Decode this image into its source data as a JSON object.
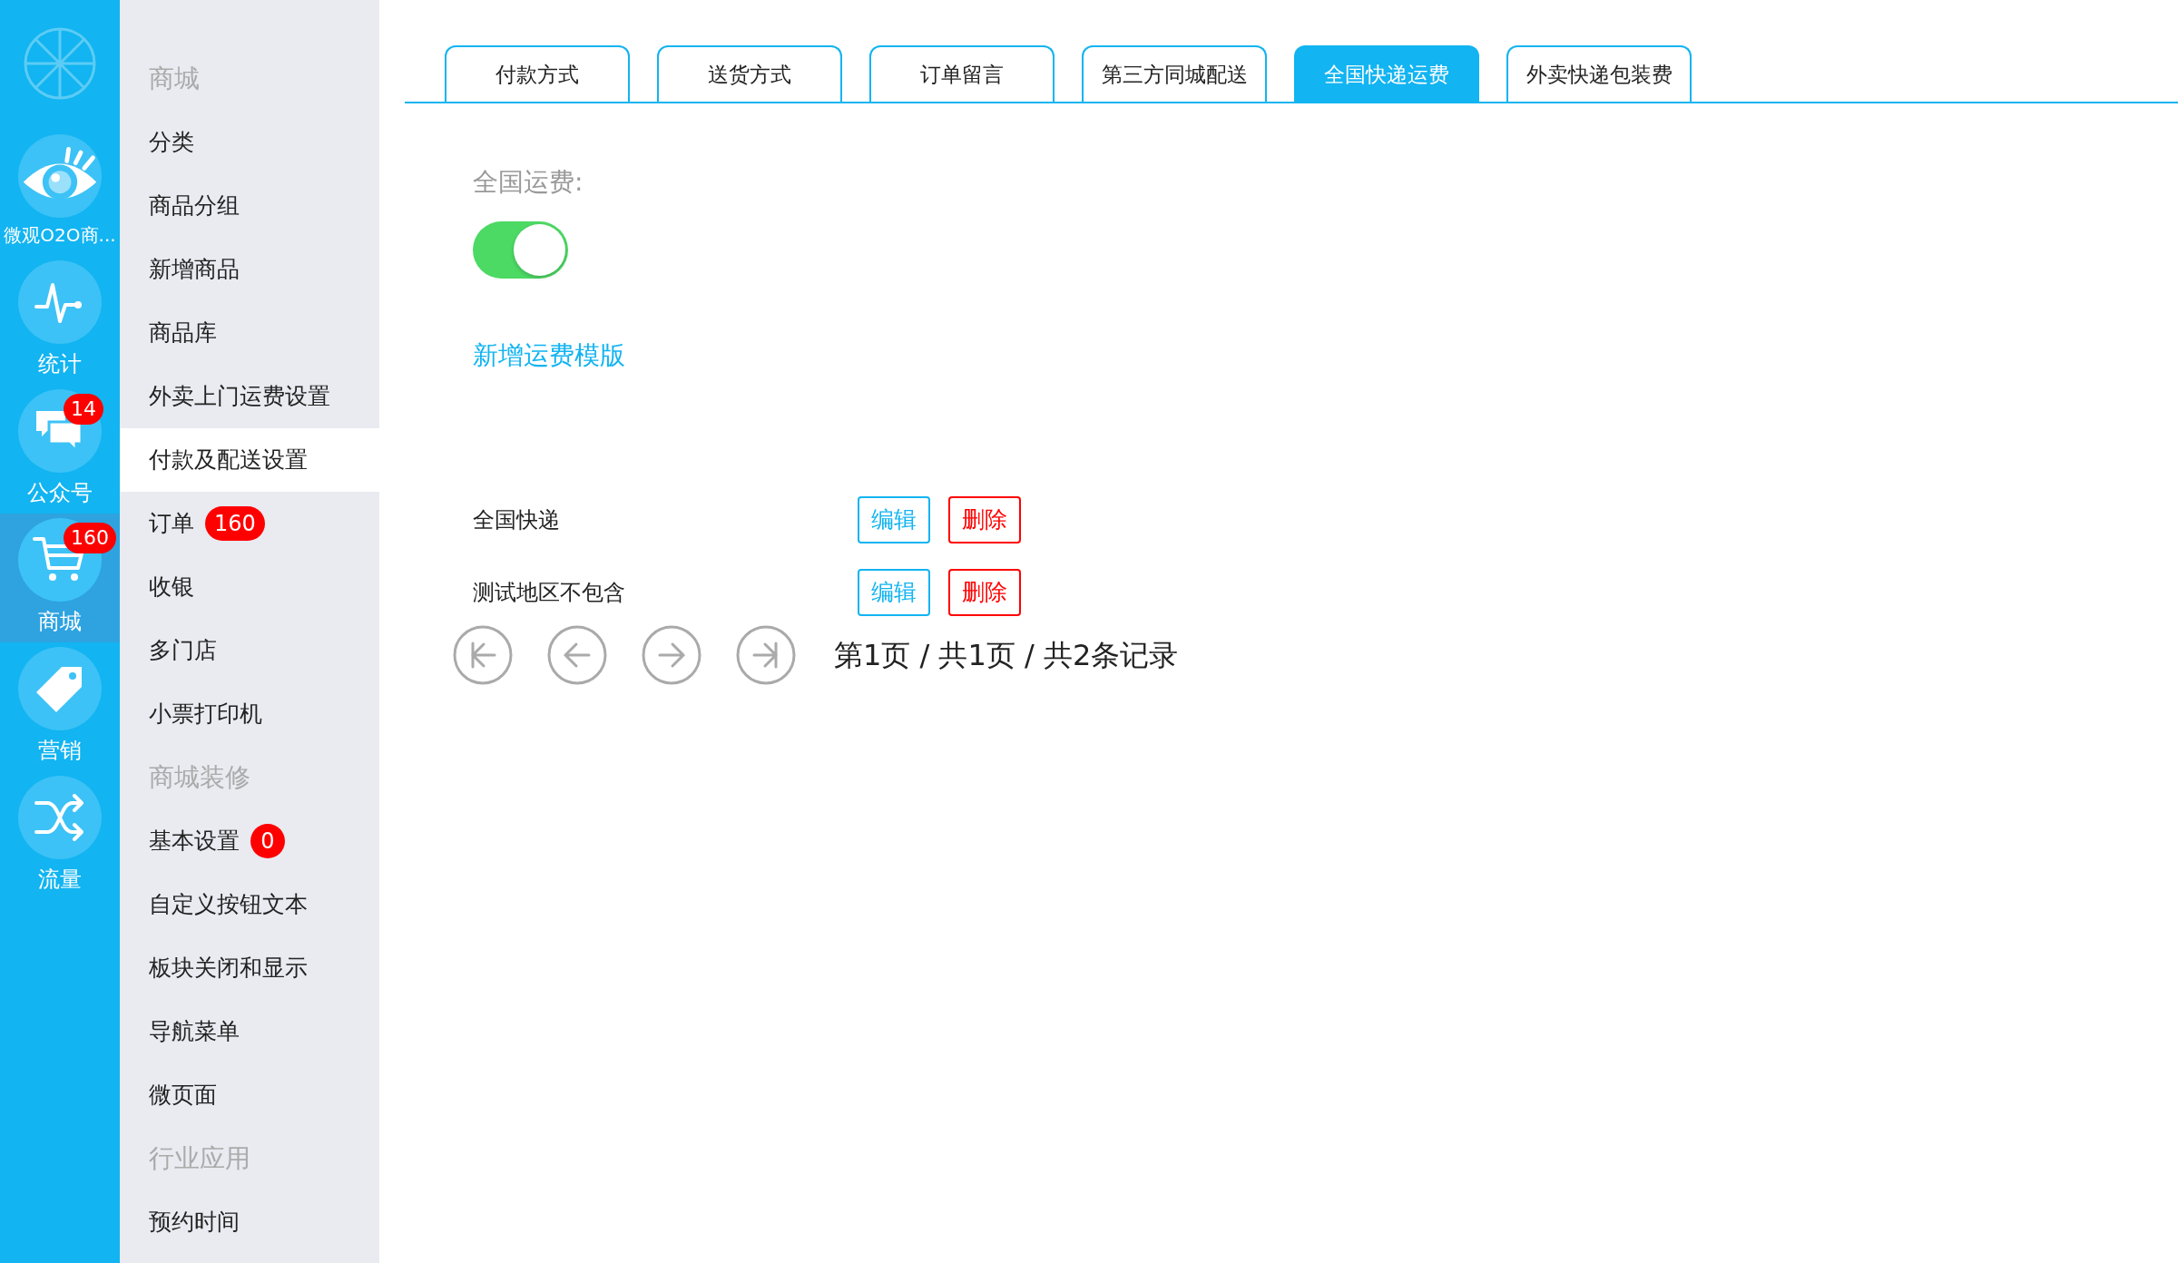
{
  "rail": {
    "items": [
      {
        "label": "微观O2O商...",
        "selected": false
      },
      {
        "label": "统计",
        "selected": false
      },
      {
        "label": "公众号",
        "badge": "14",
        "selected": false
      },
      {
        "label": "商城",
        "badge": "160",
        "selected": true
      },
      {
        "label": "营销",
        "selected": false
      },
      {
        "label": "流量",
        "selected": false
      }
    ]
  },
  "sidebar": {
    "items": [
      {
        "kind": "heading",
        "label": "商城",
        "selected": false
      },
      {
        "kind": "link",
        "label": "分类",
        "selected": false
      },
      {
        "kind": "link",
        "label": "商品分组",
        "selected": false
      },
      {
        "kind": "link",
        "label": "新增商品",
        "selected": false
      },
      {
        "kind": "link",
        "label": "商品库",
        "selected": false
      },
      {
        "kind": "link",
        "label": "外卖上门运费设置",
        "selected": false
      },
      {
        "kind": "link",
        "label": "付款及配送设置",
        "selected": true
      },
      {
        "kind": "link",
        "label": "订单",
        "badge": "160",
        "selected": false
      },
      {
        "kind": "link",
        "label": "收银",
        "selected": false
      },
      {
        "kind": "link",
        "label": "多门店",
        "selected": false
      },
      {
        "kind": "link",
        "label": "小票打印机",
        "selected": false
      },
      {
        "kind": "heading",
        "label": "商城装修",
        "selected": false
      },
      {
        "kind": "link",
        "label": "基本设置",
        "badge": "0",
        "selected": false
      },
      {
        "kind": "link",
        "label": "自定义按钮文本",
        "selected": false
      },
      {
        "kind": "link",
        "label": "板块关闭和显示",
        "selected": false
      },
      {
        "kind": "link",
        "label": "导航菜单",
        "selected": false
      },
      {
        "kind": "link",
        "label": "微页面",
        "selected": false
      },
      {
        "kind": "heading",
        "label": "行业应用",
        "selected": false
      },
      {
        "kind": "link",
        "label": "预约时间",
        "selected": false
      }
    ]
  },
  "tabs": [
    {
      "label": "付款方式",
      "selected": false
    },
    {
      "label": "送货方式",
      "selected": false
    },
    {
      "label": "订单留言",
      "selected": false
    },
    {
      "label": "第三方同城配送",
      "selected": false
    },
    {
      "label": "全国快递运费",
      "selected": true
    },
    {
      "label": "外卖快递包装费",
      "selected": false
    }
  ],
  "content": {
    "fee_label": "全国运费:",
    "fee_toggle": {
      "on": true
    },
    "add_link": "新增运费模版",
    "templates": [
      {
        "name": "全国快递",
        "edit": "编辑",
        "delete": "删除"
      },
      {
        "name": "测试地区不包含",
        "edit": "编辑",
        "delete": "删除"
      }
    ],
    "pager": {
      "text": "第1页 / 共1页 / 共2条记录"
    }
  }
}
